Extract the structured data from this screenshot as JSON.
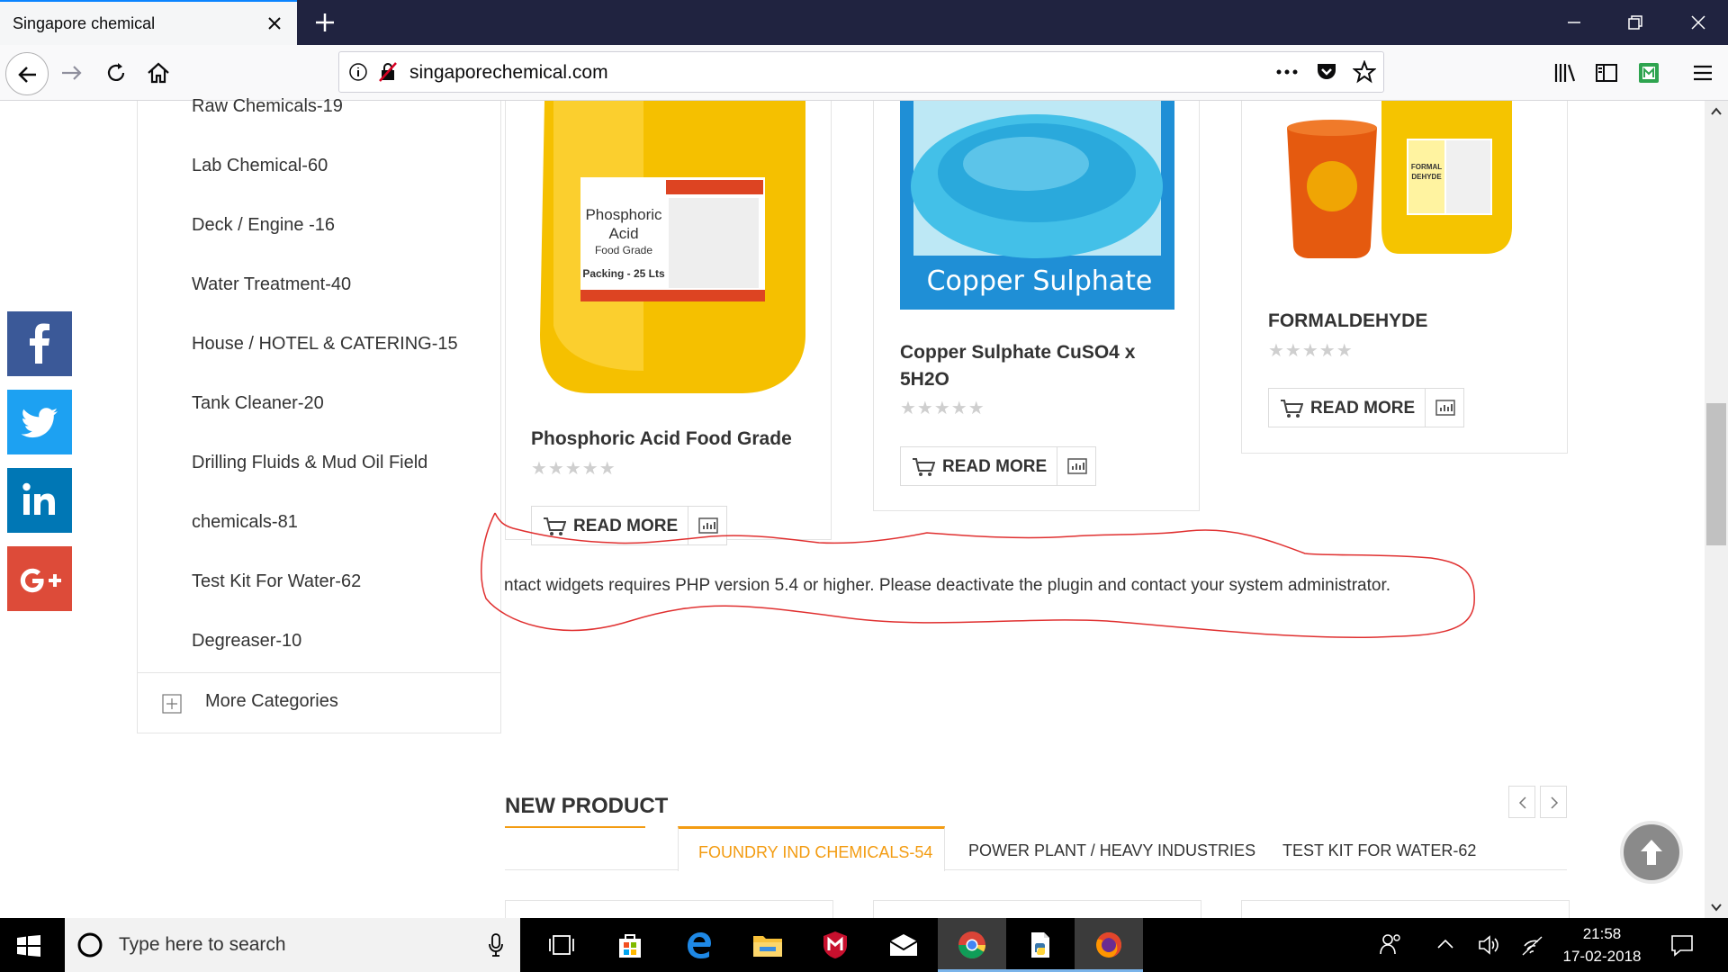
{
  "browser": {
    "tab_title": "Singapore chemical",
    "url": "singaporechemical.com",
    "accent": "#0a84ff"
  },
  "sidebar": {
    "categories": [
      "Raw Chemicals-19",
      "Lab Chemical-60",
      "Deck / Engine -16",
      "Water Treatment-40",
      "House / HOTEL & CATERING-15",
      "Tank Cleaner-20",
      "Drilling Fluids & Mud Oil Field",
      "chemicals-81",
      "Test Kit For Water-62",
      "Degreaser-10"
    ],
    "more_label": "More Categories"
  },
  "social": [
    {
      "icon": "facebook-icon",
      "glyph": "f",
      "color": "#3b5998"
    },
    {
      "icon": "twitter-icon",
      "glyph": "",
      "color": "#1da1f2"
    },
    {
      "icon": "linkedin-icon",
      "glyph": "in",
      "color": "#0077b5"
    },
    {
      "icon": "googleplus-icon",
      "glyph": "G+",
      "color": "#dd4b39"
    }
  ],
  "products": [
    {
      "name": "Phosphoric Acid Food Grade",
      "rating": 0,
      "image_label": {
        "line1": "Phosphoric",
        "line2": "Acid",
        "line3": "Food Grade",
        "line4": "Packing - 25 Lts"
      }
    },
    {
      "name": "Copper Sulphate CuSO4 x 5H2O",
      "rating": 0,
      "image_label": {
        "line1": "Copper Sulphate"
      }
    },
    {
      "name": "FORMALDEHYDE",
      "rating": 0,
      "image_label": {
        "line1": "FORMAL",
        "line2": "DEHYDE"
      }
    }
  ],
  "read_more_label": "READ MORE",
  "stars": "★★★★★",
  "error_message": "ntact widgets requires PHP version 5.4 or higher. Please deactivate the plugin and contact your system administrator.",
  "new_product": {
    "title": "NEW PRODUCT",
    "tabs": [
      "FOUNDRY IND CHEMICALS-54",
      "POWER PLANT / HEAVY INDUSTRIES",
      "TEST KIT FOR WATER-62"
    ],
    "active_tab": 0,
    "active_color": "#f39c12"
  },
  "taskbar": {
    "search_placeholder": "Type here to search",
    "time": "21:58",
    "date": "17-02-2018"
  }
}
